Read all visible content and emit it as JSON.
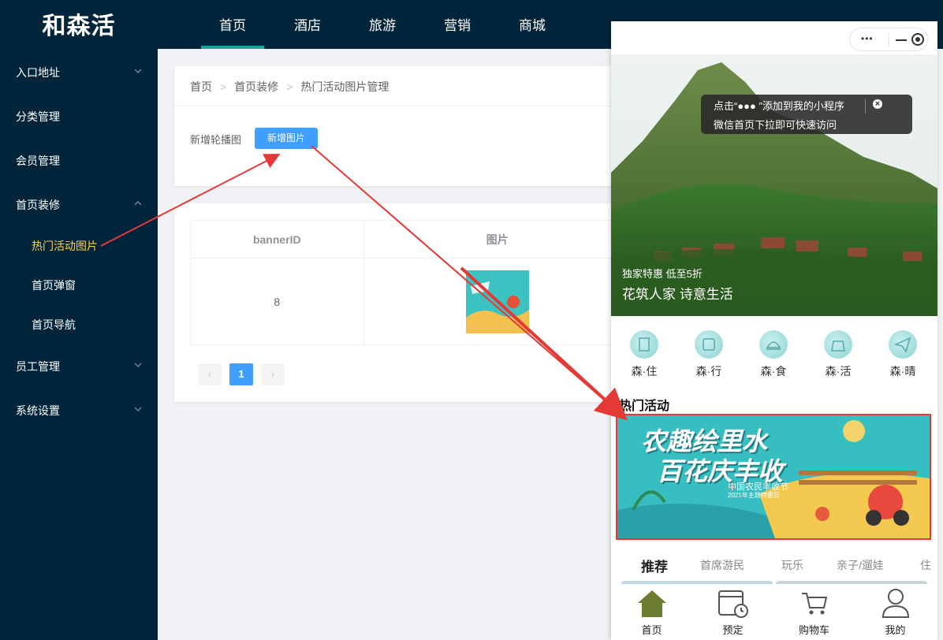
{
  "app": {
    "logo": "和森活"
  },
  "top_nav": [
    "首页",
    "酒店",
    "旅游",
    "营销",
    "商城"
  ],
  "sidebar": {
    "items": [
      {
        "label": "入口地址"
      },
      {
        "label": "分类管理"
      },
      {
        "label": "会员管理"
      },
      {
        "label": "首页装修"
      },
      {
        "label": "热门活动图片"
      },
      {
        "label": "首页弹窗"
      },
      {
        "label": "首页导航"
      },
      {
        "label": "员工管理"
      },
      {
        "label": "系统设置"
      }
    ]
  },
  "breadcrumb": [
    "首页",
    "首页装修",
    "热门活动图片管理"
  ],
  "form": {
    "label": "新增轮播图",
    "add_button": "新增图片"
  },
  "table": {
    "headers": [
      "bannerID",
      "图片"
    ],
    "rows": [
      {
        "id": "8"
      }
    ]
  },
  "pagination": {
    "current": "1",
    "prev": "‹",
    "next": "›"
  },
  "phone": {
    "capsule": {
      "more": "•••",
      "minus": "—"
    },
    "tooltip": {
      "line1": "点击“●●● ”添加到我的小程序",
      "line2": "微信首页下拉即可快速访问",
      "close": "×"
    },
    "hero": {
      "sub": "独家特惠 低至5折",
      "title": "花筑人家 诗意生活"
    },
    "categories": [
      "森·住",
      "森·行",
      "森·食",
      "森·活",
      "森·晴"
    ],
    "section_title": "热门活动",
    "banner": {
      "title1": "农趣绘里水",
      "title2": "百花庆丰收",
      "sub": "中国农民丰收节",
      "sub2": "2021年主题特惠日"
    },
    "feed_tabs": [
      "推荐",
      "首席游民",
      "玩乐",
      "亲子/遛娃",
      "住"
    ],
    "tabbar": [
      "首页",
      "预定",
      "购物车",
      "我的"
    ]
  },
  "colors": {
    "sidebar_bg": "#00253a",
    "accent": "#409eff",
    "active_menu": "#ffd04b",
    "tab_active": "#20a29c",
    "annot": "#e53935",
    "phone_green": "#6b7d2e"
  }
}
